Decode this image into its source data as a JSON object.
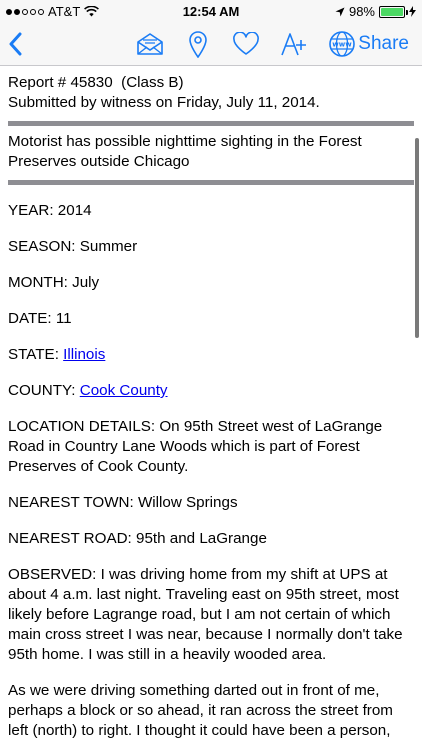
{
  "status_bar": {
    "carrier": "AT&T",
    "time": "12:54 AM",
    "battery": "98%",
    "battery_fraction": 0.98
  },
  "nav": {
    "share_label": "Share",
    "icons": [
      "back-chevron-icon",
      "mail-icon",
      "map-pin-icon",
      "heart-icon",
      "font-size-icon",
      "globe-www-icon"
    ]
  },
  "report": {
    "header_line1": "Report # 45830  (Class B)",
    "header_line2": "Submitted by witness on Friday, July 11, 2014.",
    "summary": "Motorist has possible nighttime sighting in the Forest Preserves outside Chicago",
    "year": "YEAR: 2014",
    "season": "SEASON: Summer",
    "month": "MONTH: July",
    "date": "DATE: 11",
    "state_label": "STATE: ",
    "state_value": "Illinois",
    "county_label": "COUNTY: ",
    "county_value": "Cook County",
    "location_details": "LOCATION DETAILS: On 95th Street west of LaGrange Road in Country Lane Woods which is part of Forest Preserves of Cook County.",
    "nearest_town": "NEAREST TOWN: Willow Springs",
    "nearest_road": "NEAREST ROAD: 95th and LaGrange",
    "observed": "OBSERVED: I was driving home from my shift at UPS at about 4 a.m. last night. Traveling east on 95th street, most likely before Lagrange road, but I am not certain of which main cross street I was near, because I normally don't take 95th home. I was still in a heavily wooded area.",
    "observed_cont": "As we were driving something darted out in front of me, perhaps a block or so ahead, it ran across the street from left (north) to right. I thought it could have been a person,"
  }
}
